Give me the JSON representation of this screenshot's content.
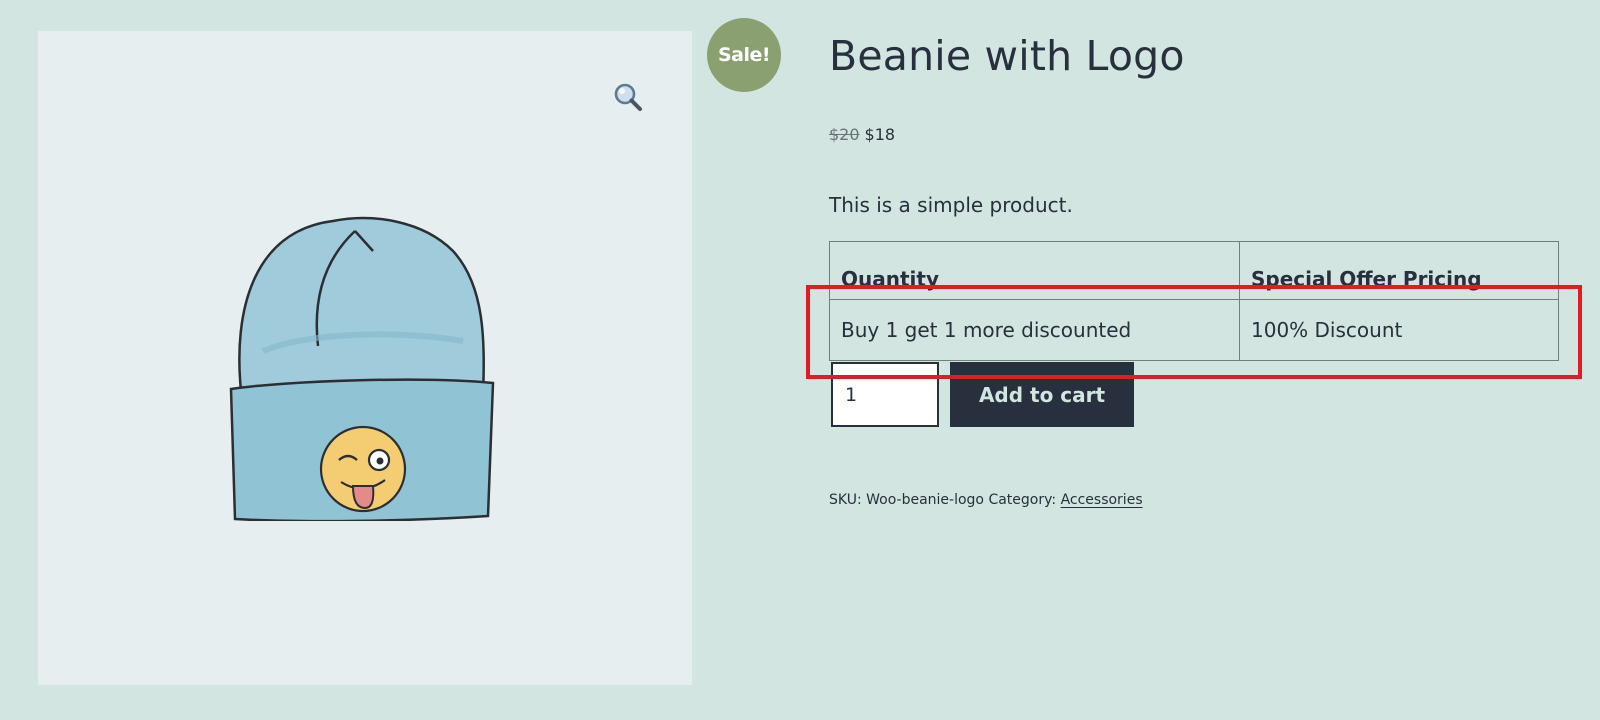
{
  "product": {
    "sale_badge": "Sale!",
    "title": "Beanie with Logo",
    "price_regular": "$20",
    "price_sale": "$18",
    "short_description": "This is a simple product.",
    "image_icon": "beanie-with-winking-emoji",
    "zoom_icon": "magnifier-icon"
  },
  "offer_table": {
    "headers": [
      "Quantity",
      "Special Offer Pricing"
    ],
    "rows": [
      [
        "Buy 1 get 1 more discounted",
        "100% Discount"
      ]
    ]
  },
  "cart": {
    "quantity_value": "1",
    "add_label": "Add to cart"
  },
  "meta": {
    "sku_label": "SKU:",
    "sku_value": "Woo-beanie-logo",
    "category_label": "Category:",
    "category_value": "Accessories"
  },
  "colors": {
    "background": "#d2e5e0",
    "text": "#28303d",
    "sale_badge": "#8aa071",
    "highlight": "#e21c24"
  }
}
